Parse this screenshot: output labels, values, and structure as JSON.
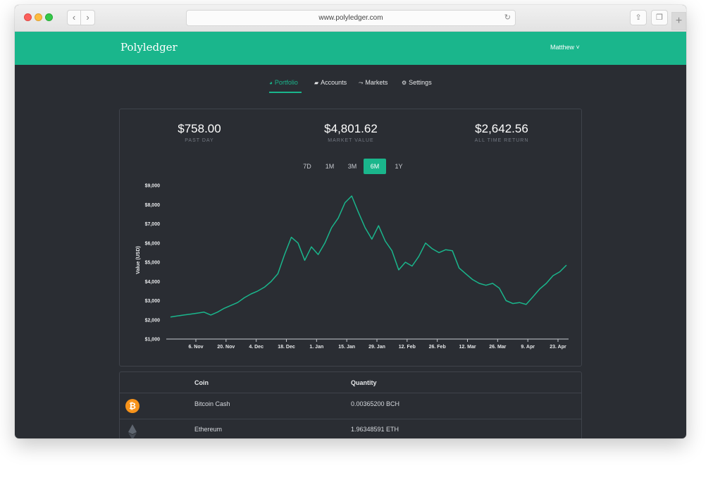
{
  "browser": {
    "url": "www.polyledger.com",
    "back_icon": "‹",
    "forward_icon": "›",
    "reload_icon": "↻",
    "share_icon": "⇪",
    "tabs_icon": "❐",
    "new_tab_icon": "+"
  },
  "header": {
    "brand": "Polyledger",
    "user_menu": "Matthew ˅",
    "accent_color": "#1ab68c"
  },
  "nav": {
    "items": [
      {
        "label": "Portfolio",
        "icon": "◕",
        "active": true
      },
      {
        "label": "Accounts",
        "icon": "▰"
      },
      {
        "label": "Markets",
        "icon": "⤳"
      },
      {
        "label": "Settings",
        "icon": "⚙"
      }
    ]
  },
  "stats": [
    {
      "value": "$758.00",
      "label": "PAST DAY"
    },
    {
      "value": "$4,801.62",
      "label": "MARKET VALUE"
    },
    {
      "value": "$2,642.56",
      "label": "ALL TIME RETURN"
    }
  ],
  "ranges": [
    "7D",
    "1M",
    "3M",
    "6M",
    "1Y"
  ],
  "selected_range": "6M",
  "chart_data": {
    "type": "line",
    "ylabel": "Value (USD)",
    "ylim": [
      1000,
      9000
    ],
    "y_ticks": [
      "$9,000",
      "$8,000",
      "$7,000",
      "$6,000",
      "$5,000",
      "$4,000",
      "$3,000",
      "$2,000",
      "$1,000"
    ],
    "x_ticks": [
      "6. Nov",
      "20. Nov",
      "4. Dec",
      "18. Dec",
      "1. Jan",
      "15. Jan",
      "29. Jan",
      "12. Feb",
      "26. Feb",
      "12. Mar",
      "26. Mar",
      "9. Apr",
      "23. Apr"
    ],
    "grid": false,
    "series": [
      {
        "color": "#1ab68c",
        "values": [
          2150,
          2200,
          2250,
          2300,
          2350,
          2400,
          2250,
          2400,
          2600,
          2750,
          2900,
          3150,
          3350,
          3500,
          3700,
          4000,
          4400,
          5400,
          6300,
          6000,
          5100,
          5800,
          5400,
          6000,
          6800,
          7300,
          8100,
          8450,
          7600,
          6800,
          6200,
          6900,
          6100,
          5600,
          4600,
          5000,
          4800,
          5300,
          6000,
          5700,
          5500,
          5650,
          5600,
          4700,
          4400,
          4100,
          3900,
          3800,
          3900,
          3650,
          3000,
          2850,
          2900,
          2800,
          3200,
          3600,
          3900,
          4300,
          4500,
          4850
        ]
      }
    ]
  },
  "table": {
    "headers": {
      "coin": "Coin",
      "quantity": "Quantity"
    },
    "rows": [
      {
        "icon": "bitcoin-cash-icon",
        "icon_glyph": "₿",
        "coin": "Bitcoin Cash",
        "quantity": "0.00365200 BCH"
      },
      {
        "icon": "ethereum-icon",
        "coin": "Ethereum",
        "quantity": "1.96348591 ETH"
      }
    ]
  }
}
